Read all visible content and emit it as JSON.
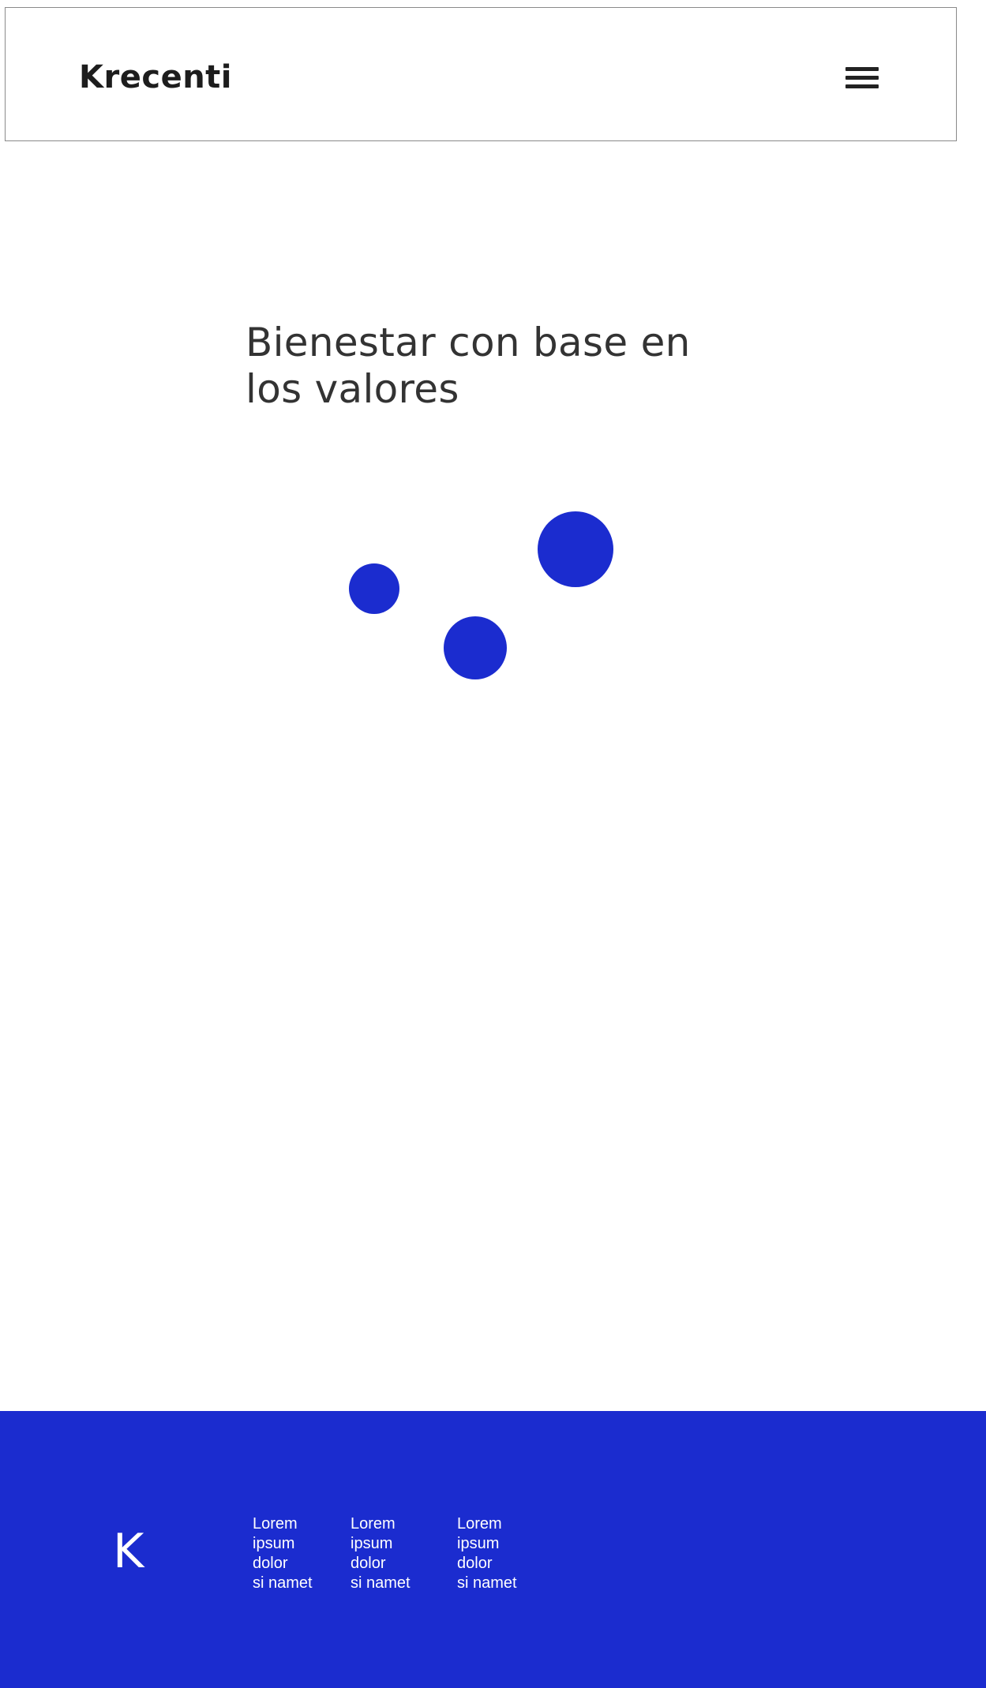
{
  "colors": {
    "accent": "#1b2ccf",
    "text": "#333333",
    "logo": "#1d1d1d",
    "footer_text": "#ffffff"
  },
  "header": {
    "logo_text": "Krecenti",
    "menu_icon": "hamburger-menu-icon"
  },
  "hero": {
    "title": "Bienestar con base en los valores"
  },
  "decorations": {
    "dots": [
      "small-dot",
      "medium-dot",
      "large-dot"
    ]
  },
  "footer": {
    "logo_letter": "K",
    "columns": [
      [
        "Lorem",
        "ipsum",
        "dolor",
        "si namet"
      ],
      [
        "Lorem",
        "ipsum",
        "dolor",
        "si namet"
      ],
      [
        "Lorem",
        "ipsum",
        "dolor",
        "si namet"
      ]
    ]
  }
}
